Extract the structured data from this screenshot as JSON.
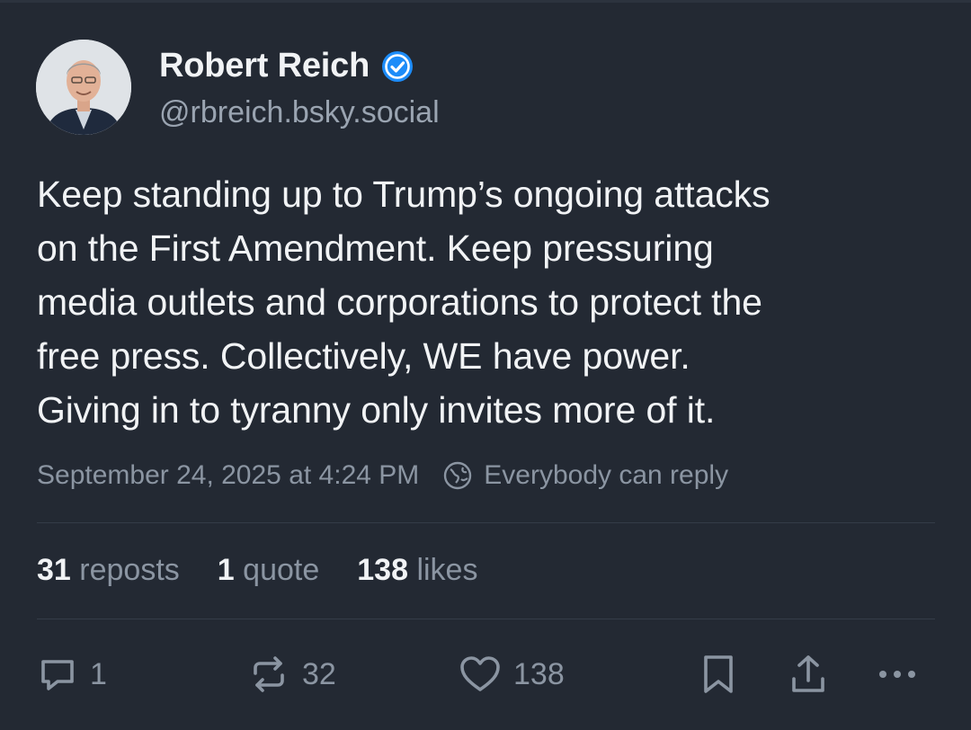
{
  "author": {
    "name": "Robert Reich",
    "handle": "@rbreich.bsky.social",
    "verified_icon": "verified-check-icon",
    "accent_color": "#1d8cf8"
  },
  "post": {
    "lines": [
      "Keep standing up to Trump’s ongoing attacks",
      "on the First Amendment. Keep pressuring",
      "media outlets and corporations to protect the",
      "free press. Collectively, WE have power.",
      "Giving in to tyranny only invites more of it."
    ],
    "timestamp": "September 24, 2025 at 4:24 PM",
    "reply_setting": "Everybody can reply"
  },
  "stats": {
    "reposts_count": "31",
    "reposts_label": "reposts",
    "quotes_count": "1",
    "quotes_label": "quote",
    "likes_count": "138",
    "likes_label": "likes"
  },
  "actions": {
    "reply_count": "1",
    "repost_count": "32",
    "like_count": "138"
  },
  "colors": {
    "background": "#232933",
    "text_primary": "#f1f3f5",
    "text_secondary": "#8b95a2"
  }
}
